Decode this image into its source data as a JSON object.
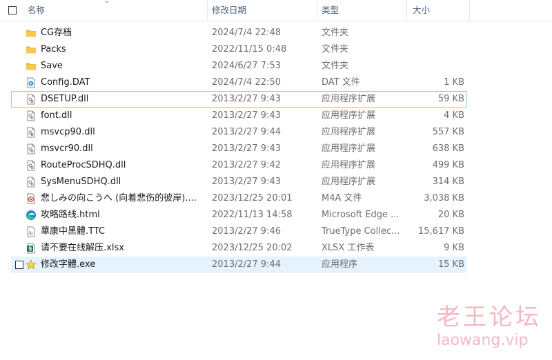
{
  "header": {
    "name": "名称",
    "date": "修改日期",
    "type": "类型",
    "size": "大小",
    "sort_indicator": "^"
  },
  "files": [
    {
      "name": "CG存档",
      "date": "2024/7/4 22:48",
      "type": "文件夹",
      "size": "",
      "icon": "folder-icon"
    },
    {
      "name": "Packs",
      "date": "2022/11/15 0:48",
      "type": "文件夹",
      "size": "",
      "icon": "folder-icon"
    },
    {
      "name": "Save",
      "date": "2024/6/27 7:53",
      "type": "文件夹",
      "size": "",
      "icon": "folder-icon"
    },
    {
      "name": "Config.DAT",
      "date": "2024/7/4 22:50",
      "type": "DAT 文件",
      "size": "1 KB",
      "icon": "media-file-icon"
    },
    {
      "name": "DSETUP.dll",
      "date": "2013/2/27 9:43",
      "type": "应用程序扩展",
      "size": "59 KB",
      "icon": "dll-file-icon"
    },
    {
      "name": "font.dll",
      "date": "2013/2/27 9:43",
      "type": "应用程序扩展",
      "size": "4 KB",
      "icon": "dll-file-icon"
    },
    {
      "name": "msvcp90.dll",
      "date": "2013/2/27 9:44",
      "type": "应用程序扩展",
      "size": "557 KB",
      "icon": "dll-file-icon"
    },
    {
      "name": "msvcr90.dll",
      "date": "2013/2/27 9:43",
      "type": "应用程序扩展",
      "size": "638 KB",
      "icon": "dll-file-icon"
    },
    {
      "name": "RouteProcSDHQ.dll",
      "date": "2013/2/27 9:42",
      "type": "应用程序扩展",
      "size": "499 KB",
      "icon": "dll-file-icon"
    },
    {
      "name": "SysMenuSDHQ.dll",
      "date": "2013/2/27 9:43",
      "type": "应用程序扩展",
      "size": "314 KB",
      "icon": "dll-file-icon"
    },
    {
      "name": "悲しみの向こうへ (向着悲伤的彼岸)....",
      "date": "2023/12/25 20:01",
      "type": "M4A 文件",
      "size": "3,038 KB",
      "icon": "audio-file-icon"
    },
    {
      "name": "攻略路线.html",
      "date": "2022/11/13 14:58",
      "type": "Microsoft Edge ...",
      "size": "20 KB",
      "icon": "edge-html-icon"
    },
    {
      "name": "華康中黑體.TTC",
      "date": "2013/2/27 9:46",
      "type": "TrueType Collec...",
      "size": "15,617 KB",
      "icon": "font-file-icon"
    },
    {
      "name": "请不要在线解压.xlsx",
      "date": "2023/12/25 20:02",
      "type": "XLSX 工作表",
      "size": "9 KB",
      "icon": "spreadsheet-icon"
    },
    {
      "name": "修改字體.exe",
      "date": "2013/2/27 9:44",
      "type": "应用程序",
      "size": "15 KB",
      "icon": "star-exe-icon"
    }
  ],
  "watermark": {
    "title": "老王论坛",
    "url": "laowang.vip"
  },
  "colors": {
    "selected_bg": "#e5f3ff",
    "focus_border": "#99c9ef",
    "header_text": "#4c607a",
    "folder": "#f3c442",
    "watermark": "#f5b8c2"
  }
}
